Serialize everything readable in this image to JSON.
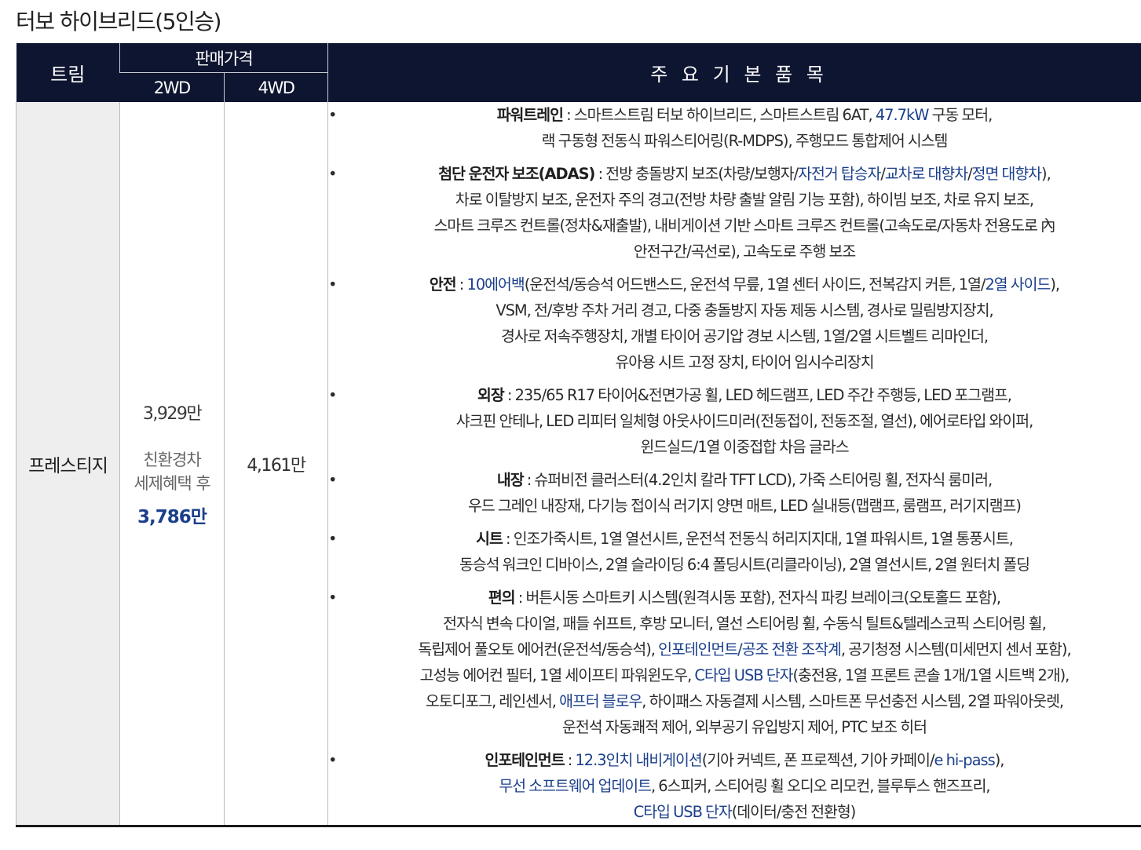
{
  "page_title": "터보 하이브리드(5인승)",
  "header": {
    "trim": "트림",
    "price": "판매가격",
    "2wd": "2WD",
    "4wd": "4WD",
    "features": "주 요 기 본 품 목"
  },
  "row": {
    "trim": "프레스티지",
    "price_2wd": "3,929만",
    "eco_label_1": "친환경차",
    "eco_label_2": "세제혜택 후",
    "eco_price": "3,786만",
    "price_4wd": "4,161만"
  },
  "features": [
    {
      "label": "파워트레인",
      "lines": [
        [
          {
            "t": " : 스마트스트림 터보 하이브리드, 스마트스트림 6AT, "
          },
          {
            "t": "47.7kW",
            "hl": true
          },
          {
            "t": " 구동 모터,"
          }
        ],
        [
          {
            "t": "랙 구동형 전동식 파워스티어링(R-MDPS), 주행모드 통합제어 시스템"
          }
        ]
      ]
    },
    {
      "label": "첨단 운전자 보조(ADAS)",
      "lines": [
        [
          {
            "t": " : 전방 충돌방지 보조(차량/보행자/"
          },
          {
            "t": "자전거 탑승자",
            "hl": true
          },
          {
            "t": "/"
          },
          {
            "t": "교차로 대향차",
            "hl": true
          },
          {
            "t": "/"
          },
          {
            "t": "정면 대향차",
            "hl": true
          },
          {
            "t": "),"
          }
        ],
        [
          {
            "t": "차로 이탈방지 보조, 운전자 주의 경고(전방 차량 출발 알림 기능 포함), 하이빔 보조, 차로 유지 보조,"
          }
        ],
        [
          {
            "t": "스마트 크루즈 컨트롤(정차&재출발), 내비게이션 기반 스마트 크루즈 컨트롤(고속도로/자동차 전용도로 內"
          }
        ],
        [
          {
            "t": "안전구간/곡선로), 고속도로 주행 보조"
          }
        ]
      ]
    },
    {
      "label": "안전",
      "lines": [
        [
          {
            "t": " : "
          },
          {
            "t": "10에어백",
            "hl": true
          },
          {
            "t": "(운전석/동승석 어드밴스드, 운전석 무릎, 1열 센터 사이드, 전복감지 커튼, 1열/"
          },
          {
            "t": "2열 사이드",
            "hl": true
          },
          {
            "t": "),"
          }
        ],
        [
          {
            "t": "VSM, 전/후방 주차 거리 경고, 다중 충돌방지 자동 제동 시스템, 경사로 밀림방지장치,"
          }
        ],
        [
          {
            "t": "경사로 저속주행장치, 개별 타이어 공기압 경보 시스템, 1열/2열 시트벨트 리마인더,"
          }
        ],
        [
          {
            "t": "유아용 시트 고정 장치, 타이어 임시수리장치"
          }
        ]
      ]
    },
    {
      "label": "외장",
      "lines": [
        [
          {
            "t": " : 235/65 R17 타이어&전면가공 휠, LED 헤드램프, LED 주간 주행등, LED 포그램프,"
          }
        ],
        [
          {
            "t": "샤크핀 안테나, LED 리피터 일체형 아웃사이드미러(전동접이, 전동조절, 열선), 에어로타입 와이퍼,"
          }
        ],
        [
          {
            "t": "윈드실드/1열 이중접합 차음 글라스"
          }
        ]
      ]
    },
    {
      "label": "내장",
      "lines": [
        [
          {
            "t": " : 슈퍼비전 클러스터(4.2인치 칼라 TFT LCD), 가죽 스티어링 휠, 전자식 룸미러,"
          }
        ],
        [
          {
            "t": "우드 그레인 내장재, 다기능 접이식 러기지 양면 매트, LED 실내등(맵램프, 룸램프, 러기지램프)"
          }
        ]
      ]
    },
    {
      "label": "시트",
      "lines": [
        [
          {
            "t": " : 인조가죽시트, 1열 열선시트, 운전석 전동식 허리지지대, 1열 파워시트, 1열 통풍시트,"
          }
        ],
        [
          {
            "t": "동승석 워크인 디바이스, 2열 슬라이딩 6:4 폴딩시트(리클라이닝), 2열 열선시트, 2열 원터치 폴딩"
          }
        ]
      ]
    },
    {
      "label": "편의",
      "lines": [
        [
          {
            "t": " : 버튼시동 스마트키 시스템(원격시동 포함), 전자식 파킹 브레이크(오토홀드 포함),"
          }
        ],
        [
          {
            "t": "전자식 변속 다이얼, 패들 쉬프트, 후방 모니터, 열선 스티어링 휠, 수동식 틸트&텔레스코픽 스티어링 휠,"
          }
        ],
        [
          {
            "t": "독립제어 풀오토 에어컨(운전석/동승석), "
          },
          {
            "t": "인포테인먼트/공조 전환 조작계",
            "hl": true
          },
          {
            "t": ", 공기청정 시스템(미세먼지 센서 포함),"
          }
        ],
        [
          {
            "t": "고성능 에어컨 필터, 1열 세이프티 파워윈도우, "
          },
          {
            "t": "C타입 USB 단자",
            "hl": true
          },
          {
            "t": "(충전용, 1열 프론트 콘솔 1개/1열 시트백 2개),"
          }
        ],
        [
          {
            "t": "오토디포그, 레인센서, "
          },
          {
            "t": "애프터 블로우",
            "hl": true
          },
          {
            "t": ", 하이패스 자동결제 시스템, 스마트폰 무선충전 시스템, 2열 파워아웃렛,"
          }
        ],
        [
          {
            "t": "운전석 자동쾌적 제어, 외부공기 유입방지 제어, PTC 보조 히터"
          }
        ]
      ]
    },
    {
      "label": "인포테인먼트",
      "lines": [
        [
          {
            "t": " : "
          },
          {
            "t": "12.3인치 내비게이션",
            "hl": true
          },
          {
            "t": "(기아 커넥트, 폰 프로젝션, 기아 카페이/"
          },
          {
            "t": "e hi-pass",
            "hl": true
          },
          {
            "t": "),"
          }
        ],
        [
          {
            "t": "무선 소프트웨어 업데이트",
            "hl": true
          },
          {
            "t": ", 6스피커, 스티어링 휠 오디오 리모컨, 블루투스 핸즈프리,"
          }
        ],
        [
          {
            "t": "C타입 USB 단자",
            "hl": true
          },
          {
            "t": "(데이터/충전 전환형)"
          }
        ]
      ]
    }
  ]
}
